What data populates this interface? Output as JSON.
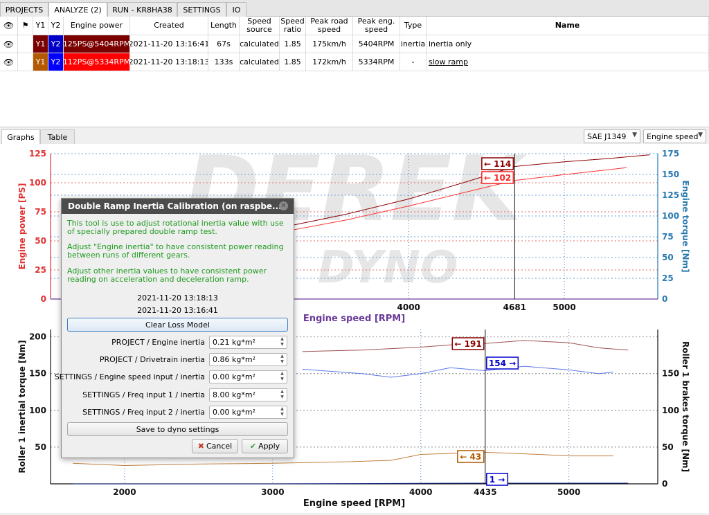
{
  "top_tabs": [
    {
      "label": "PROJECTS"
    },
    {
      "label": "ANALYZE (2)"
    },
    {
      "label": "RUN - KR8HA38"
    },
    {
      "label": "SETTINGS"
    },
    {
      "label": "IO"
    }
  ],
  "runs_table": {
    "headers": {
      "flag": "⚑",
      "y1": "Y1",
      "y2": "Y2",
      "engine_power": "Engine power",
      "created": "Created",
      "length": "Length",
      "speed_source": "Speed source",
      "speed_ratio": "Speed ratio",
      "peak_road_speed": "Peak road speed",
      "peak_eng_speed": "Peak eng. speed",
      "type": "Type",
      "name": "Name"
    },
    "rows": [
      {
        "y1": "Y1",
        "y2": "Y2",
        "engine_power": "125PS@5404RPM",
        "created": "2021-11-20 13:16:41",
        "length": "67s",
        "speed_source": "calculated",
        "speed_ratio": "1.85",
        "peak_road_speed": "175km/h",
        "peak_eng_speed": "5404RPM",
        "type": "inertia",
        "name": "inertia only",
        "y1_color": "#7a0000",
        "y2_color": "#0000c8",
        "power_color": "#7a0000"
      },
      {
        "y1": "Y1",
        "y2": "Y2",
        "engine_power": "112PS@5334RPM",
        "created": "2021-11-20 13:18:13",
        "length": "133s",
        "speed_source": "calculated",
        "speed_ratio": "1.85",
        "peak_road_speed": "172km/h",
        "peak_eng_speed": "5334RPM",
        "type": "-",
        "name": "slow ramp",
        "y1_color": "#b35a00",
        "y2_color": "#0000ff",
        "power_color": "#ff0000"
      }
    ]
  },
  "view_tabs": [
    {
      "label": "Graphs"
    },
    {
      "label": "Table"
    }
  ],
  "correction_select": {
    "value": "SAE J1349"
  },
  "xaxis_select": {
    "value": "Engine speed"
  },
  "watermark": {
    "top": "DEREK",
    "bottom": "DYNO"
  },
  "chart_data": [
    {
      "type": "line",
      "xlabel": "Engine speed [RPM]",
      "ylabel": "Engine power [PS]",
      "ylabel_right": "Engine torque [Nm]",
      "xlim": [
        1700,
        5600
      ],
      "ylim": [
        0,
        125
      ],
      "ylim_right": [
        0,
        175
      ],
      "xticks": [
        "4000",
        "4681",
        "5000"
      ],
      "yticks": [
        "0",
        "25",
        "50",
        "75",
        "100",
        "125"
      ],
      "yticks_right": [
        "0",
        "25",
        "50",
        "75",
        "100",
        "125",
        "150",
        "175"
      ],
      "cursor_x": 4681,
      "cursor_labels": [
        "← 114",
        "← 102"
      ],
      "series": [
        {
          "x": [
            3200,
            3600,
            4000,
            4400,
            4681,
            5000,
            5300,
            5550
          ],
          "values": [
            62,
            73,
            86,
            102,
            114,
            118,
            121,
            124
          ],
          "color": "#8b0000"
        },
        {
          "x": [
            3200,
            3600,
            4000,
            4400,
            4681,
            5000,
            5200,
            5400
          ],
          "values": [
            58,
            68,
            80,
            93,
            102,
            107,
            110,
            113
          ],
          "color": "#ff3030"
        }
      ]
    },
    {
      "type": "line",
      "xlabel": "Engine speed [RPM]",
      "ylabel": "Roller 1 inertial torque [Nm]",
      "ylabel_right": "Roller 1 brakes torque [Nm]",
      "xlim": [
        1500,
        5600
      ],
      "ylim": [
        0,
        210
      ],
      "ylim_right": [
        0,
        210
      ],
      "xticks": [
        "2000",
        "3000",
        "4000",
        "4435",
        "5000"
      ],
      "yticks": [
        "50",
        "100",
        "150",
        "200"
      ],
      "yticks_right": [
        "0",
        "50",
        "100",
        "150"
      ],
      "cursor_x": 4435,
      "cursor_labels": [
        "← 191",
        "154 →",
        "← 43",
        "1 →"
      ],
      "series": [
        {
          "x": [
            3200,
            3600,
            4000,
            4200,
            4435,
            4700,
            5000,
            5200,
            5400
          ],
          "values": [
            180,
            182,
            186,
            189,
            191,
            195,
            192,
            185,
            182
          ],
          "color": "#a05050"
        },
        {
          "x": [
            3200,
            3600,
            3800,
            4000,
            4200,
            4435,
            4700,
            5000,
            5200,
            5300
          ],
          "values": [
            156,
            150,
            145,
            150,
            158,
            154,
            160,
            155,
            150,
            152
          ],
          "color": "#5a78e8"
        },
        {
          "x": [
            1650,
            2000,
            2500,
            3000,
            3500,
            3800,
            4000,
            4435,
            4800,
            5000,
            5300
          ],
          "values": [
            28,
            25,
            27,
            28,
            30,
            32,
            40,
            43,
            40,
            38,
            38
          ],
          "color": "#c08040"
        },
        {
          "x": [
            1650,
            3000,
            4435,
            5400
          ],
          "values": [
            0,
            0,
            1,
            1
          ],
          "color": "#1a2a8a"
        }
      ]
    }
  ],
  "dialog": {
    "title": "Double Ramp Inertia Calibration (on raspbe...",
    "text1": "This tool is use to adjust rotational inertia value with use of specially prepared double ramp test.",
    "text2": "Adjust \"Engine inertia\" to have consistent power reading between runs of different gears.",
    "text3": "Adjust other inertia values to have consistent power reading on acceleration and deceleration ramp.",
    "date1": "2021-11-20 13:18:13",
    "date2": "2021-11-20 13:16:41",
    "clear_button": "Clear Loss Model",
    "fields": [
      {
        "label": "PROJECT / Engine inertia",
        "value": "0.21 kg*m²"
      },
      {
        "label": "PROJECT / Drivetrain inertia",
        "value": "0.86 kg*m²"
      },
      {
        "label": "SETTINGS / Engine speed input / inertia",
        "value": "0.00 kg*m²"
      },
      {
        "label": "SETTINGS / Freq input 1 / inertia",
        "value": "8.00 kg*m²"
      },
      {
        "label": "SETTINGS / Freq input 2 / inertia",
        "value": "0.00 kg*m²"
      }
    ],
    "save_button": "Save to dyno settings",
    "cancel_button": "Cancel",
    "apply_button": "Apply"
  },
  "colors": {
    "power_axis": "#e03030",
    "torque_axis": "#2a7ab0",
    "xaxis_label": "#6a3a9a"
  }
}
